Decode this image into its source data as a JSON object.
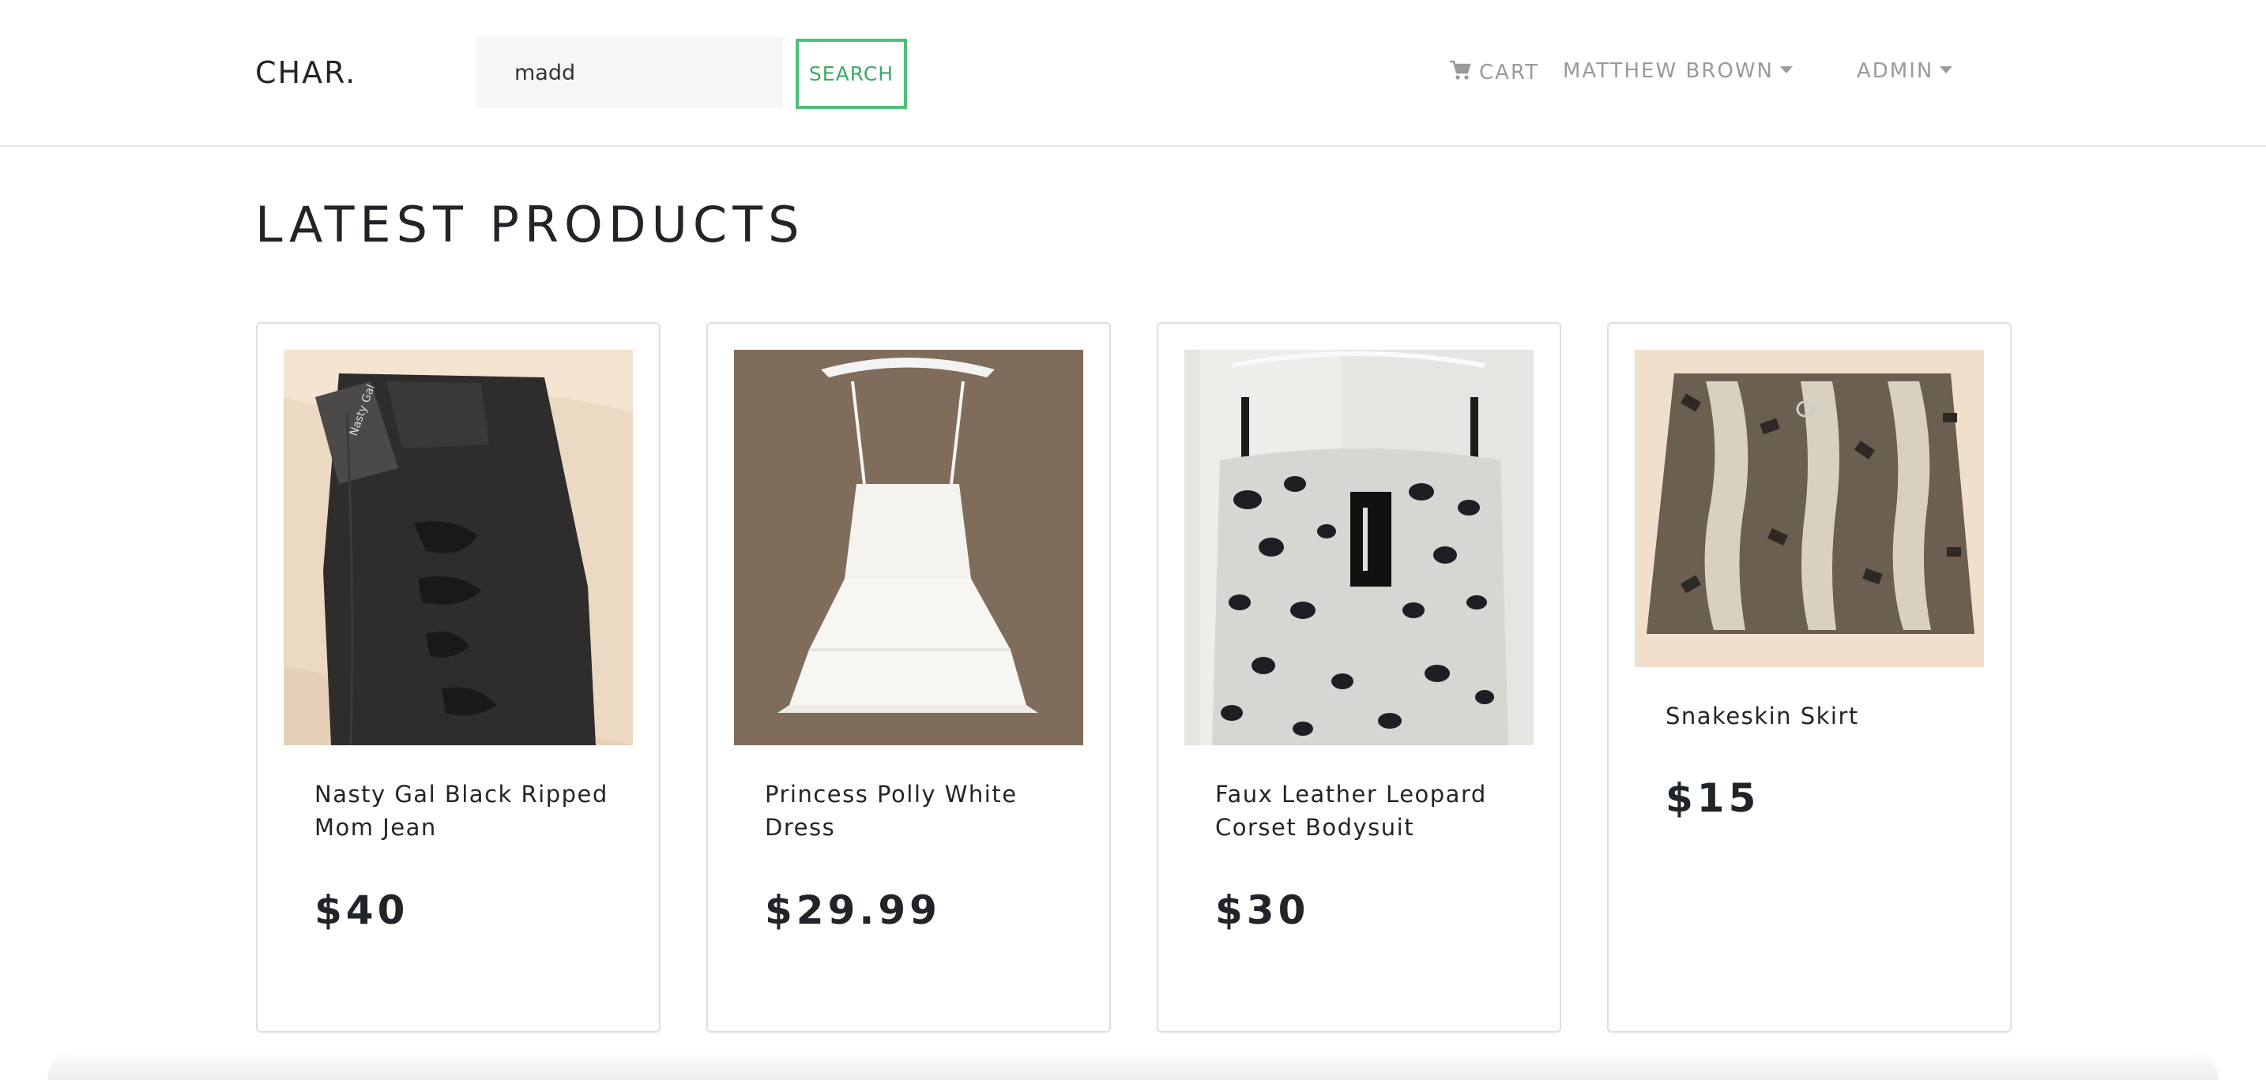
{
  "navbar": {
    "brand": "CHAR.",
    "search": {
      "value": "madd",
      "button_label": "SEARCH"
    },
    "cart_label": "CART",
    "user_label": "MATTHEW BROWN",
    "admin_label": "ADMIN",
    "icons": {
      "cart": "cart-icon",
      "dropdown": "caret-down-icon"
    }
  },
  "main": {
    "title": "LATEST PRODUCTS",
    "products": [
      {
        "name": "Nasty Gal Black Ripped Mom Jean",
        "price": "$40",
        "image": "black-ripped-jeans-photo"
      },
      {
        "name": "Princess Polly White Dress",
        "price": "$29.99",
        "image": "white-dress-photo"
      },
      {
        "name": "Faux Leather Leopard Corset Bodysuit",
        "price": "$30",
        "image": "leopard-corset-photo"
      },
      {
        "name": "Snakeskin Skirt",
        "price": "$15",
        "image": "snakeskin-skirt-photo"
      }
    ]
  },
  "colors": {
    "accent": "#4fbf7a",
    "nav_text": "#9a9a9a",
    "text": "#212529"
  }
}
